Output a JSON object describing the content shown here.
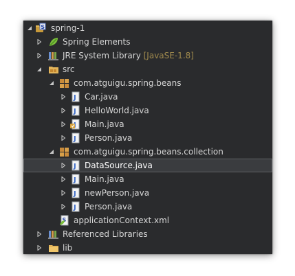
{
  "tree": {
    "project": {
      "label": "spring-1",
      "icon": "project-icon"
    },
    "spring_elements": {
      "label": "Spring Elements",
      "icon": "spring-leaf-icon"
    },
    "jre": {
      "label": "JRE System Library",
      "suffix": "[JavaSE-1.8]",
      "icon": "library-icon"
    },
    "src": {
      "label": "src",
      "icon": "source-folder-icon"
    },
    "pkg1": {
      "label": "com.atguigu.spring.beans",
      "icon": "package-icon",
      "files": [
        {
          "label": "Car.java",
          "icon": "java-file-icon"
        },
        {
          "label": "HelloWorld.java",
          "icon": "java-file-icon"
        },
        {
          "label": "Main.java",
          "icon": "java-main-file-icon"
        },
        {
          "label": "Person.java",
          "icon": "java-file-icon"
        }
      ]
    },
    "pkg2": {
      "label": "com.atguigu.spring.beans.collection",
      "icon": "package-icon",
      "files": [
        {
          "label": "DataSource.java",
          "icon": "java-file-icon"
        },
        {
          "label": "Main.java",
          "icon": "java-file-icon"
        },
        {
          "label": "newPerson.java",
          "icon": "java-file-icon"
        },
        {
          "label": "Person.java",
          "icon": "java-file-icon"
        }
      ]
    },
    "appctx": {
      "label": "applicationContext.xml",
      "icon": "spring-xml-file-icon"
    },
    "reflibs": {
      "label": "Referenced Libraries",
      "icon": "library-icon"
    },
    "lib": {
      "label": "lib",
      "icon": "folder-icon"
    }
  },
  "colors": {
    "background": "#2a2b2d",
    "text": "#d6d6d6",
    "selection": "#3a3c3f",
    "suffix": "#a08a4d"
  }
}
